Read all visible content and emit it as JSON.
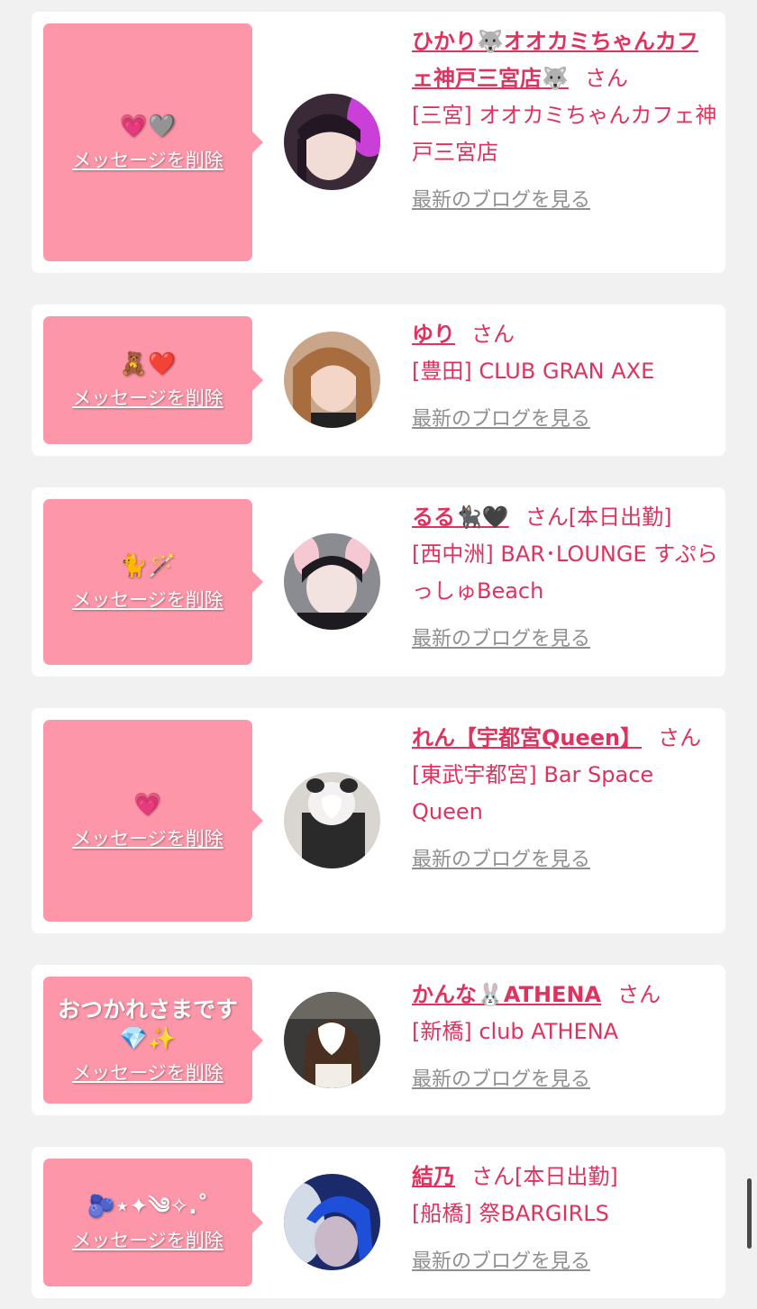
{
  "delete_label": "メッセージを削除",
  "blog_label": "最新のブログを見る",
  "colors": {
    "accent": "#e0325e",
    "bubble": "#fd96a9",
    "muted": "#8f8f8f"
  },
  "entries": [
    {
      "message": "💗🩶",
      "name": "ひかり🐺オオカミちゃんカフェ神戸三宮店🐺",
      "suffix": "さん",
      "shop": "[三宮] オオカミちゃんカフェ神戸三宮店"
    },
    {
      "message": "🧸❤️",
      "name": "ゆり",
      "suffix": "さん",
      "shop": "[豊田] CLUB GRAN AXE"
    },
    {
      "message": "🐈🪄",
      "name": "るる🐈‍⬛🖤",
      "suffix": "さん[本日出勤]",
      "shop": "[西中洲] BAR･LOUNGE すぷらっしゅBeach"
    },
    {
      "message": "💗",
      "name": "れん【宇都宮Queen】",
      "suffix": "さん",
      "shop": "[東武宇都宮] Bar Space Queen"
    },
    {
      "message": "おつかれさまです💎✨",
      "name": "かんな🐰ATHENA",
      "suffix": "さん",
      "shop": "[新橋] club ATHENA"
    },
    {
      "message": "🫐⋆✦︎༄✧︎.˚",
      "name": "結乃",
      "suffix": "さん[本日出勤]",
      "shop": "[船橋] 祭BARGIRLS"
    }
  ]
}
